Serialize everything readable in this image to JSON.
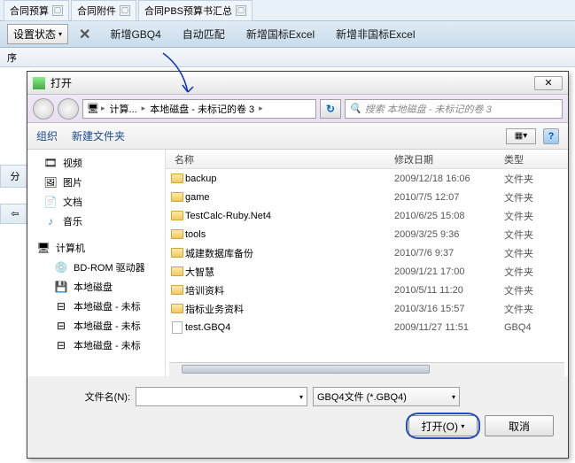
{
  "tabs": [
    "合同预算",
    "合同附件",
    "合同PBS预算书汇总"
  ],
  "toolbar": {
    "state": "设置状态",
    "new": "新增GBQ4",
    "auto": "自动匹配",
    "newgb": "新增国标Excel",
    "newngb": "新增非国标Excel"
  },
  "header_seq": "序",
  "left": {
    "fen": "分",
    "row": "⇦"
  },
  "dialog": {
    "title": "打开",
    "breadcrumb": {
      "pc": "计算...",
      "disk": "本地磁盘 - 未标记的卷 3"
    },
    "search_placeholder": "搜索 本地磁盘 - 未标记的卷 3",
    "organize": "组织",
    "newfolder": "新建文件夹",
    "view_label": "▦▾",
    "nav": {
      "video": "视频",
      "pic": "图片",
      "doc": "文档",
      "music": "音乐",
      "computer": "计算机",
      "bdrom": "BD-ROM 驱动器",
      "disk1": "本地磁盘",
      "disk2": "本地磁盘 - 未标",
      "disk3": "本地磁盘 - 未标",
      "disk4": "本地磁盘 - 未标"
    },
    "cols": {
      "name": "名称",
      "date": "修改日期",
      "type": "类型"
    },
    "rows": [
      {
        "n": "backup",
        "d": "2009/12/18 16:06",
        "t": "文件夹",
        "f": true
      },
      {
        "n": "game",
        "d": "2010/7/5 12:07",
        "t": "文件夹",
        "f": true
      },
      {
        "n": "TestCalc-Ruby.Net4",
        "d": "2010/6/25 15:08",
        "t": "文件夹",
        "f": true
      },
      {
        "n": "tools",
        "d": "2009/3/25 9:36",
        "t": "文件夹",
        "f": true
      },
      {
        "n": "城建数据库备份",
        "d": "2010/7/6 9:37",
        "t": "文件夹",
        "f": true
      },
      {
        "n": "大智慧",
        "d": "2009/1/21 17:00",
        "t": "文件夹",
        "f": true
      },
      {
        "n": "培训资料",
        "d": "2010/5/11 11:20",
        "t": "文件夹",
        "f": true
      },
      {
        "n": "指标业务资料",
        "d": "2010/3/16 15:57",
        "t": "文件夹",
        "f": true
      },
      {
        "n": "test.GBQ4",
        "d": "2009/11/27 11:51",
        "t": "GBQ4",
        "f": false
      }
    ],
    "filename_label": "文件名(N):",
    "filter": "GBQ4文件 (*.GBQ4)",
    "open": "打开(O)",
    "cancel": "取消"
  }
}
